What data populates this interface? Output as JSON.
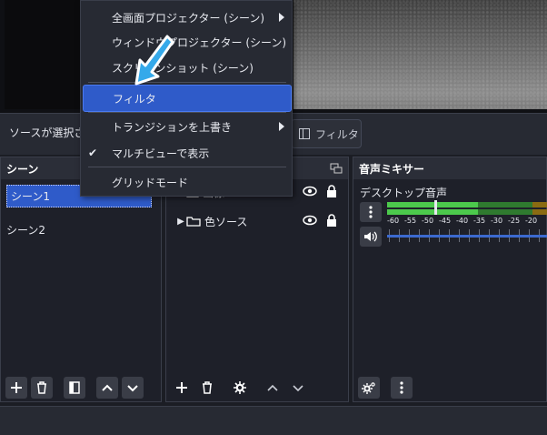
{
  "source_bar": {
    "status_text": "ソースが選択され",
    "filter_button_label": "フィルタ"
  },
  "scenes": {
    "title": "シーン",
    "items": [
      {
        "label": "シーン1",
        "selected": true
      },
      {
        "label": "シーン2",
        "selected": false
      }
    ],
    "toolbar": [
      "add-icon",
      "trash-icon",
      "filter-icon",
      "up-icon",
      "down-icon"
    ]
  },
  "sources": {
    "items": [
      {
        "label": "画像",
        "type": "image-icon",
        "expandable": false
      },
      {
        "label": "色ソース",
        "type": "folder-icon",
        "expandable": true
      }
    ],
    "toolbar": [
      "add-icon",
      "trash-icon",
      "gear-icon",
      "up-icon",
      "down-icon"
    ]
  },
  "mixer": {
    "title": "音声ミキサー",
    "channel_name": "デスクトップ音声",
    "scale_labels": [
      "-60",
      "-55",
      "-50",
      "-45",
      "-40",
      "-35",
      "-30",
      "-25",
      "-20"
    ],
    "accent_color": "#3c6ad0",
    "toolbar": [
      "gears-icon",
      "more-icon"
    ]
  },
  "context_menu": {
    "items": [
      {
        "label": "全画面プロジェクター (シーン)",
        "submenu": true
      },
      {
        "label": "ウィンドウプロジェクター (シーン)",
        "submenu": false
      },
      {
        "label": "スクリーンショット (シーン)",
        "submenu": false
      },
      {
        "label": "フィルタ",
        "highlighted": true
      },
      {
        "label": "トランジションを上書き",
        "submenu": true
      },
      {
        "label": "マルチビューで表示",
        "checked": true
      },
      {
        "label": "グリッドモード",
        "submenu": false
      }
    ],
    "highlight_color": "#2f5bc9"
  },
  "cursor": {
    "color": "#35a9ea"
  }
}
